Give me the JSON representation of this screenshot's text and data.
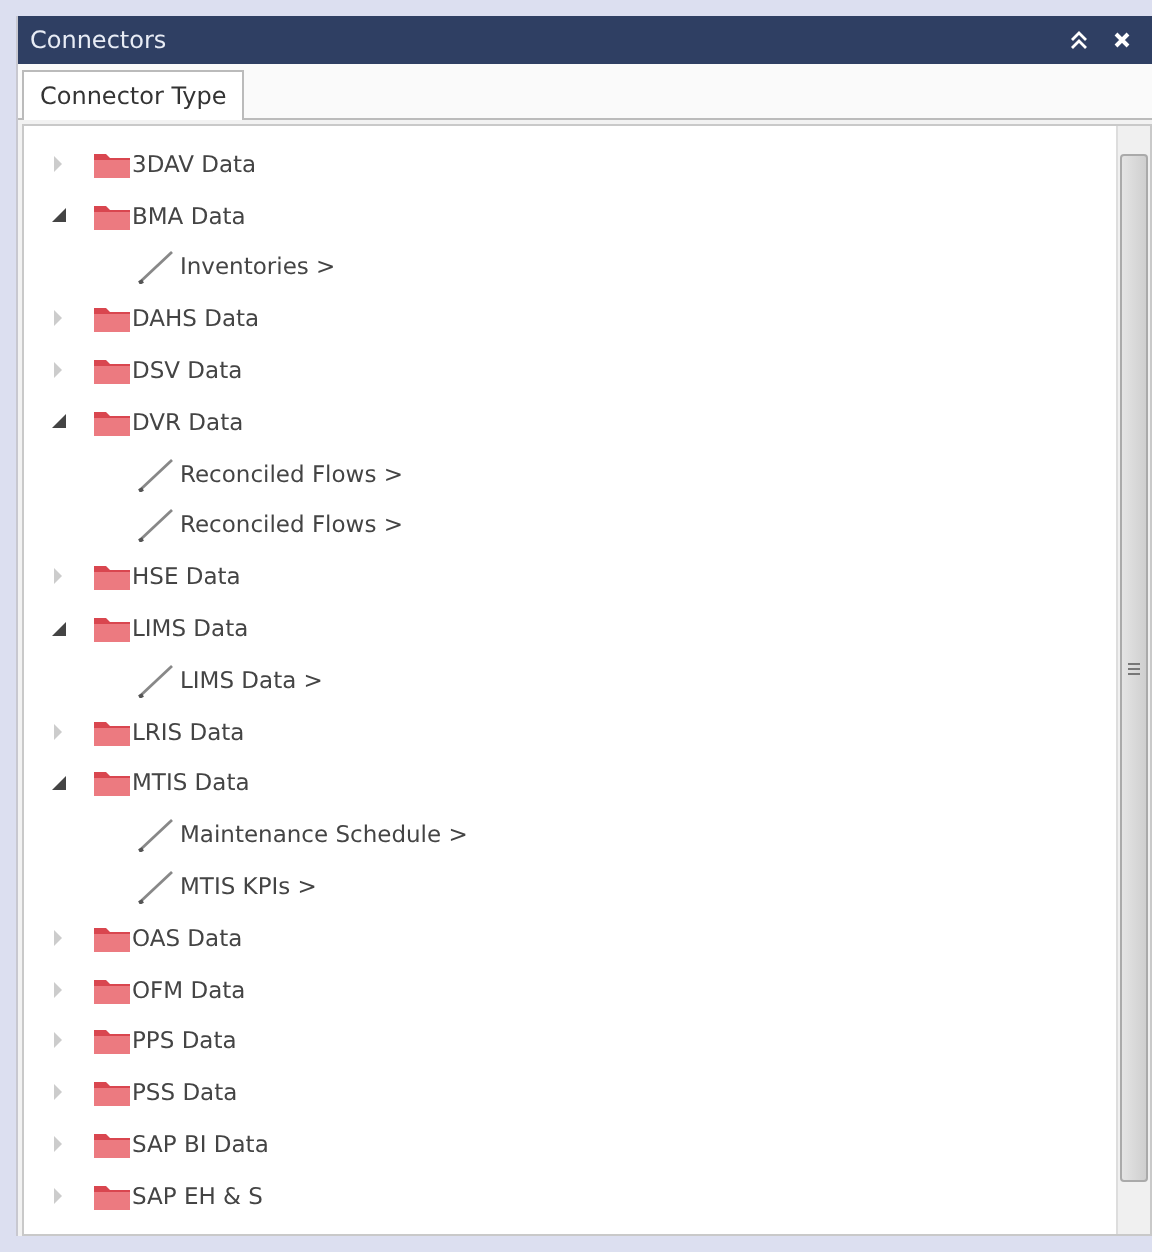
{
  "window": {
    "title": "Connectors"
  },
  "tabs": [
    {
      "label": "Connector Type",
      "selected": true
    }
  ],
  "tree": [
    {
      "label": "3DAV Data",
      "expanded": false
    },
    {
      "label": "BMA Data",
      "expanded": true,
      "children": [
        {
          "label": "Inventories >"
        }
      ]
    },
    {
      "label": "DAHS Data",
      "expanded": false
    },
    {
      "label": "DSV Data",
      "expanded": false
    },
    {
      "label": "DVR Data",
      "expanded": true,
      "children": [
        {
          "label": "Reconciled Flows >"
        },
        {
          "label": "Reconciled Flows >"
        }
      ]
    },
    {
      "label": "HSE Data",
      "expanded": false
    },
    {
      "label": "LIMS Data",
      "expanded": true,
      "children": [
        {
          "label": "LIMS Data >"
        }
      ]
    },
    {
      "label": "LRIS Data",
      "expanded": false
    },
    {
      "label": "MTIS Data",
      "expanded": true,
      "children": [
        {
          "label": "Maintenance Schedule >"
        },
        {
          "label": "MTIS KPIs >"
        }
      ]
    },
    {
      "label": "OAS Data",
      "expanded": false
    },
    {
      "label": "OFM Data",
      "expanded": false
    },
    {
      "label": "PPS Data",
      "expanded": false
    },
    {
      "label": "PSS Data",
      "expanded": false
    },
    {
      "label": "SAP BI Data",
      "expanded": false
    },
    {
      "label": "SAP EH & S",
      "expanded": false
    }
  ]
}
